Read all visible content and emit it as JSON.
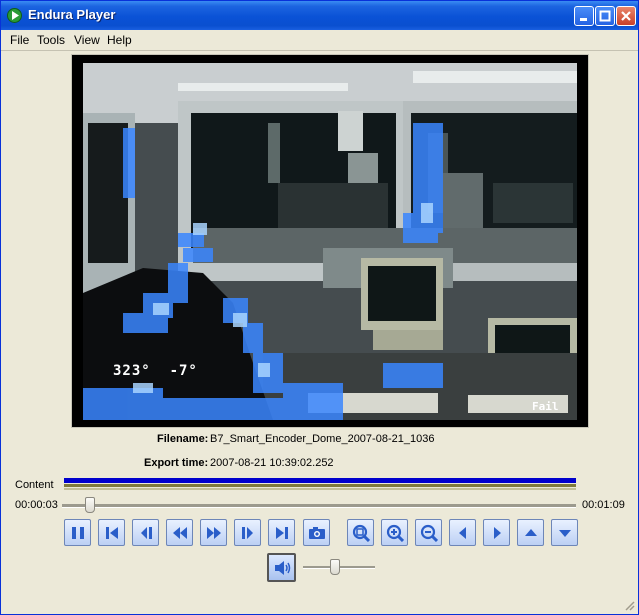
{
  "window": {
    "title": "Endura Player"
  },
  "menu": {
    "items": [
      "File",
      "Tools",
      "View",
      "Help"
    ]
  },
  "video": {
    "osd_direction": "323°  -7°",
    "osd_status": "Fail"
  },
  "info": {
    "filename_label": "Filename:",
    "filename": "B7_Smart_Encoder_Dome_2007-08-21_1036",
    "export_label": "Export time:",
    "export_time": "2007-08-21 10:39:02.252"
  },
  "timeline": {
    "content_label": "Content",
    "current_time": "00:00:03",
    "total_time": "00:01:09",
    "position_fraction": 0.045
  },
  "controls": {
    "buttons": [
      "pause",
      "go-to-start",
      "step-back",
      "rewind",
      "fast-forward",
      "step-forward",
      "go-to-end",
      "snapshot",
      "zoom-fit",
      "zoom-in",
      "zoom-out",
      "pan-left",
      "pan-right",
      "pan-up",
      "pan-down"
    ]
  },
  "volume": {
    "level_fraction": 0.45
  },
  "colors": {
    "titlebar": "#0a52d6",
    "button_face": "#c9daf8",
    "icon_blue": "#2a5ec9",
    "content_bar": "#0000cc"
  }
}
